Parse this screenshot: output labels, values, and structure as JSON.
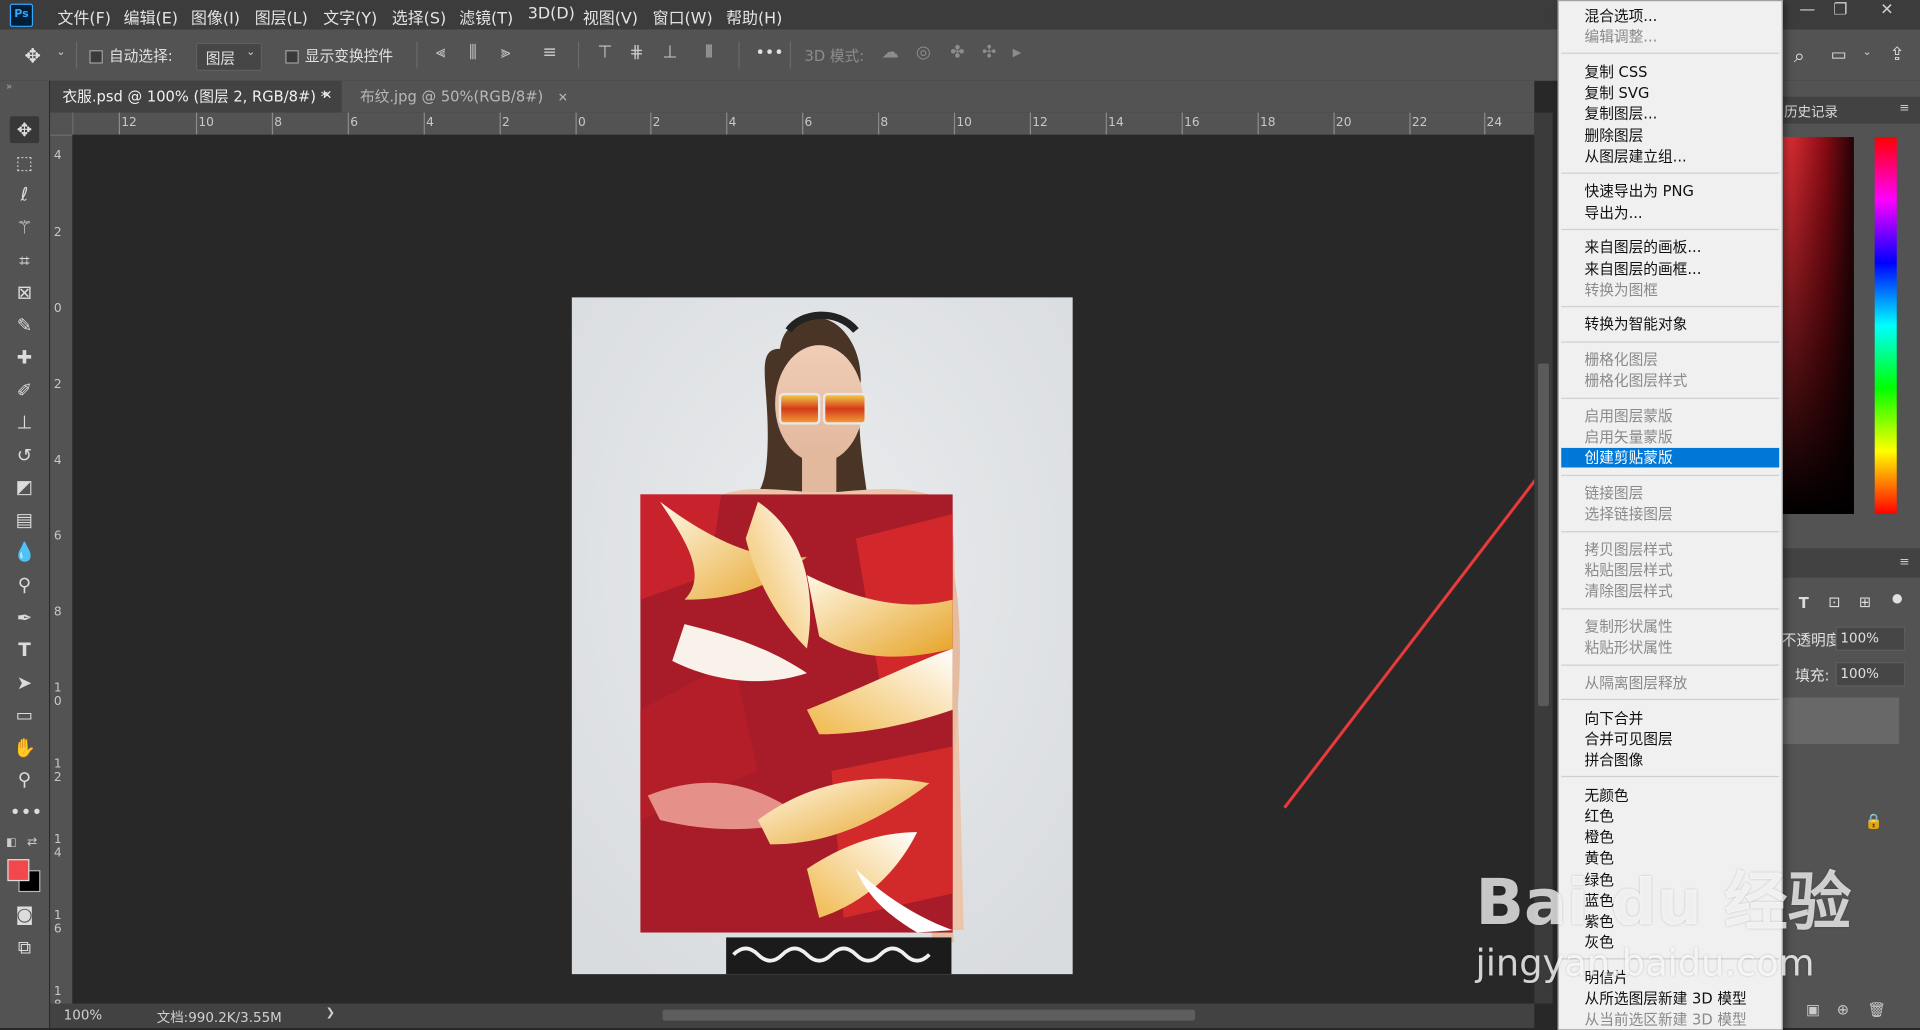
{
  "app": {
    "logo": "Ps"
  },
  "menubar": {
    "items": [
      "文件(F)",
      "编辑(E)",
      "图像(I)",
      "图层(L)",
      "文字(Y)",
      "选择(S)",
      "滤镜(T)",
      "3D(D)",
      "视图(V)",
      "窗口(W)",
      "帮助(H)"
    ],
    "window_buttons": [
      "—",
      "❐",
      "✕"
    ]
  },
  "options": {
    "auto_select_label": "自动选择:",
    "auto_select_value": "图层",
    "show_transform_label": "显示变换控件",
    "more": "•••",
    "mode_3d_label": "3D 模式:"
  },
  "tabs": [
    {
      "label": "衣服.psd @ 100% (图层 2, RGB/8#) *",
      "close": "✕"
    },
    {
      "label": "布纹.jpg @ 50%(RGB/8#)",
      "close": "✕"
    }
  ],
  "ruler": {
    "h": [
      "12",
      "10",
      "8",
      "6",
      "4",
      "2",
      "0",
      "2",
      "4",
      "6",
      "8",
      "10",
      "12",
      "14",
      "16",
      "18",
      "20",
      "22",
      "24"
    ],
    "v": [
      "4",
      "2",
      "0",
      "2",
      "4",
      "6",
      "8",
      "1\n0",
      "1\n2",
      "1\n4",
      "1\n6",
      "1\n8"
    ]
  },
  "status": {
    "zoom": "100%",
    "doc": "文档:990.2K/3.55M",
    "arrow": "❯"
  },
  "context_menu": {
    "groups": [
      [
        {
          "label": "混合选项...",
          "enabled": true
        },
        {
          "label": "编辑调整...",
          "enabled": false
        }
      ],
      [
        {
          "label": "复制 CSS",
          "enabled": true
        },
        {
          "label": "复制 SVG",
          "enabled": true
        },
        {
          "label": "复制图层...",
          "enabled": true
        },
        {
          "label": "删除图层",
          "enabled": true
        },
        {
          "label": "从图层建立组...",
          "enabled": true
        }
      ],
      [
        {
          "label": "快速导出为 PNG",
          "enabled": true
        },
        {
          "label": "导出为...",
          "enabled": true
        }
      ],
      [
        {
          "label": "来自图层的画板...",
          "enabled": true
        },
        {
          "label": "来自图层的画框...",
          "enabled": true
        },
        {
          "label": "转换为图框",
          "enabled": false
        }
      ],
      [
        {
          "label": "转换为智能对象",
          "enabled": true
        }
      ],
      [
        {
          "label": "栅格化图层",
          "enabled": false
        },
        {
          "label": "栅格化图层样式",
          "enabled": false
        }
      ],
      [
        {
          "label": "启用图层蒙版",
          "enabled": false
        },
        {
          "label": "启用矢量蒙版",
          "enabled": false
        },
        {
          "label": "创建剪贴蒙版",
          "enabled": true,
          "highlighted": true
        }
      ],
      [
        {
          "label": "链接图层",
          "enabled": false
        },
        {
          "label": "选择链接图层",
          "enabled": false
        }
      ],
      [
        {
          "label": "拷贝图层样式",
          "enabled": false
        },
        {
          "label": "粘贴图层样式",
          "enabled": false
        },
        {
          "label": "清除图层样式",
          "enabled": false
        }
      ],
      [
        {
          "label": "复制形状属性",
          "enabled": false
        },
        {
          "label": "粘贴形状属性",
          "enabled": false
        }
      ],
      [
        {
          "label": "从隔离图层释放",
          "enabled": false
        }
      ],
      [
        {
          "label": "向下合并",
          "enabled": true
        },
        {
          "label": "合并可见图层",
          "enabled": true
        },
        {
          "label": "拼合图像",
          "enabled": true
        }
      ],
      [
        {
          "label": "无颜色",
          "enabled": true
        },
        {
          "label": "红色",
          "enabled": true
        },
        {
          "label": "橙色",
          "enabled": true
        },
        {
          "label": "黄色",
          "enabled": true
        },
        {
          "label": "绿色",
          "enabled": true
        },
        {
          "label": "蓝色",
          "enabled": true
        },
        {
          "label": "紫色",
          "enabled": true
        },
        {
          "label": "灰色",
          "enabled": true
        }
      ],
      [
        {
          "label": "明信片",
          "enabled": true
        },
        {
          "label": "从所选图层新建 3D 模型",
          "enabled": true
        },
        {
          "label": "从当前选区新建 3D 模型",
          "enabled": false
        }
      ]
    ]
  },
  "panels": {
    "history_tab": "历史记录",
    "opacity_label": "不透明度:",
    "opacity_value": "100%",
    "fill_label": "填充:",
    "fill_value": "100%"
  },
  "watermark": {
    "brand": "Bai du 经验",
    "url": "jingyan.baidu.com"
  },
  "colors": {
    "foreground": "#f2474b",
    "background": "#000000",
    "highlight": "#0078d7",
    "arrow": "#e83a3a"
  }
}
